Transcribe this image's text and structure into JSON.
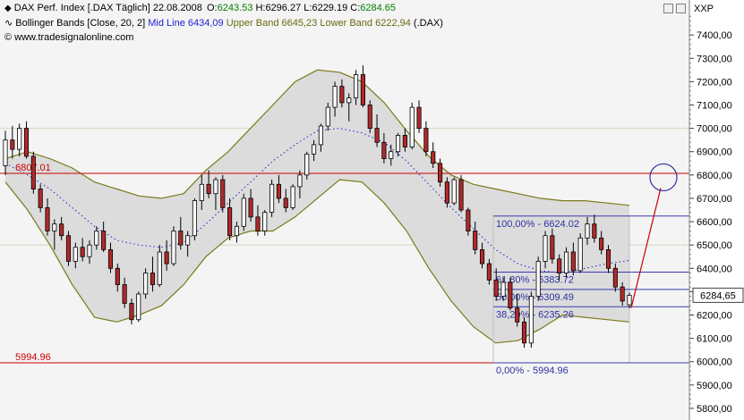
{
  "header": {
    "line1": {
      "icon": "diamond-arrow-icon",
      "symbol": "DAX Perf. Index [.DAX  Täglich]",
      "date": "22.08.2008",
      "open_label": "O:",
      "open_value": "6243.53",
      "high_label": "H:",
      "high_value": "6296.27",
      "low_label": "L:",
      "low_value": "6229.19",
      "close_label": "C:",
      "close_value": "6284.65"
    },
    "line2": {
      "icon": "wave-icon",
      "indicator": "Bollinger Bands [Close, 20, 2]",
      "mid": "Mid Line 6434,09",
      "upper": "Upper Band 6645,23",
      "lower": "Lower Band 6222,94",
      "symbol": "(.DAX)"
    },
    "line3": {
      "icon": "copyright-icon",
      "text": "www.tradesignalonline.com"
    }
  },
  "axis_label": "XXP",
  "price_badge": "6284,65",
  "colors": {
    "candle_up": "#ffffff",
    "candle_down": "#b02a2a",
    "band": "#7a7a1a",
    "band_fill": "#dcdcdc",
    "mid": "#2020d0",
    "fib": "#3a3ab0",
    "fib_label": "#3030a0",
    "hline_red": "#cc0000",
    "open_color": "#008000",
    "high_color": "#000000",
    "close_color": "#008000",
    "upper_color": "#2020d0"
  },
  "chart_data": {
    "type": "candlestick",
    "ylim": [
      5750,
      7550
    ],
    "y_ticks": [
      5800,
      5900,
      6000,
      6100,
      6200,
      6300,
      6400,
      6500,
      6600,
      6700,
      6800,
      6900,
      7000,
      7100,
      7200,
      7300,
      7400
    ],
    "y_tick_labels": [
      "5800,00",
      "5900,00",
      "6000,00",
      "6100,00",
      "6200,00",
      "6300,00",
      "6400,00",
      "6500,00",
      "6600,00",
      "6700,00",
      "6800,00",
      "6900,00",
      "7000,00",
      "7100,00",
      "7200,00",
      "7300,00",
      "7400,00"
    ],
    "green_hlines": [
      7000,
      6500
    ],
    "red_hlines": [
      {
        "value": 6807.01,
        "label": "6807.01"
      },
      {
        "value": 5994.96,
        "label": "5994.96"
      }
    ],
    "fib_levels": [
      {
        "value": 6624.02,
        "label": "100,00% - 6624.02"
      },
      {
        "value": 6383.72,
        "label": "61,80% - 6383.72"
      },
      {
        "value": 6309.49,
        "label": "50,00% - 6309.49"
      },
      {
        "value": 6235.26,
        "label": "38,20% - 6235.26"
      },
      {
        "value": 5994.96,
        "label": "0,00% - 5994.96"
      }
    ],
    "candles": [
      [
        6840,
        6990,
        6800,
        6950
      ],
      [
        6950,
        7010,
        6870,
        6910
      ],
      [
        6910,
        7020,
        6880,
        7000
      ],
      [
        7000,
        7030,
        6870,
        6880
      ],
      [
        6880,
        6900,
        6720,
        6740
      ],
      [
        6740,
        6760,
        6640,
        6660
      ],
      [
        6660,
        6700,
        6540,
        6560
      ],
      [
        6560,
        6610,
        6480,
        6590
      ],
      [
        6590,
        6620,
        6520,
        6540
      ],
      [
        6540,
        6560,
        6410,
        6430
      ],
      [
        6430,
        6510,
        6400,
        6490
      ],
      [
        6490,
        6530,
        6430,
        6450
      ],
      [
        6450,
        6520,
        6420,
        6500
      ],
      [
        6500,
        6580,
        6480,
        6560
      ],
      [
        6560,
        6600,
        6470,
        6480
      ],
      [
        6480,
        6510,
        6380,
        6400
      ],
      [
        6400,
        6420,
        6300,
        6330
      ],
      [
        6330,
        6360,
        6230,
        6250
      ],
      [
        6250,
        6270,
        6160,
        6180
      ],
      [
        6180,
        6300,
        6170,
        6290
      ],
      [
        6290,
        6400,
        6270,
        6380
      ],
      [
        6380,
        6450,
        6300,
        6330
      ],
      [
        6330,
        6500,
        6320,
        6470
      ],
      [
        6470,
        6520,
        6390,
        6420
      ],
      [
        6420,
        6580,
        6410,
        6560
      ],
      [
        6560,
        6620,
        6480,
        6500
      ],
      [
        6500,
        6560,
        6450,
        6540
      ],
      [
        6540,
        6700,
        6520,
        6690
      ],
      [
        6690,
        6800,
        6650,
        6760
      ],
      [
        6760,
        6820,
        6700,
        6720
      ],
      [
        6720,
        6790,
        6650,
        6780
      ],
      [
        6780,
        6800,
        6640,
        6660
      ],
      [
        6660,
        6700,
        6520,
        6540
      ],
      [
        6540,
        6600,
        6510,
        6580
      ],
      [
        6580,
        6720,
        6560,
        6700
      ],
      [
        6700,
        6740,
        6600,
        6620
      ],
      [
        6620,
        6670,
        6540,
        6560
      ],
      [
        6560,
        6650,
        6540,
        6640
      ],
      [
        6640,
        6780,
        6620,
        6760
      ],
      [
        6760,
        6800,
        6680,
        6700
      ],
      [
        6700,
        6740,
        6640,
        6660
      ],
      [
        6660,
        6760,
        6650,
        6750
      ],
      [
        6750,
        6820,
        6700,
        6800
      ],
      [
        6800,
        6900,
        6780,
        6890
      ],
      [
        6890,
        6950,
        6860,
        6930
      ],
      [
        6930,
        7020,
        6900,
        7010
      ],
      [
        7010,
        7110,
        6990,
        7090
      ],
      [
        7090,
        7200,
        7050,
        7180
      ],
      [
        7180,
        7210,
        7090,
        7110
      ],
      [
        7110,
        7150,
        7030,
        7130
      ],
      [
        7130,
        7250,
        7100,
        7230
      ],
      [
        7230,
        7270,
        7090,
        7100
      ],
      [
        7100,
        7120,
        6980,
        7000
      ],
      [
        7000,
        7060,
        6920,
        6940
      ],
      [
        6940,
        6980,
        6850,
        6870
      ],
      [
        6870,
        6930,
        6840,
        6900
      ],
      [
        6900,
        6980,
        6880,
        6970
      ],
      [
        6970,
        7000,
        6900,
        6920
      ],
      [
        6920,
        7110,
        6910,
        7090
      ],
      [
        7090,
        7120,
        6980,
        7000
      ],
      [
        7000,
        7030,
        6880,
        6900
      ],
      [
        6900,
        6940,
        6830,
        6850
      ],
      [
        6850,
        6870,
        6750,
        6770
      ],
      [
        6770,
        6790,
        6660,
        6680
      ],
      [
        6680,
        6790,
        6670,
        6780
      ],
      [
        6780,
        6800,
        6640,
        6650
      ],
      [
        6650,
        6660,
        6540,
        6560
      ],
      [
        6560,
        6600,
        6460,
        6480
      ],
      [
        6480,
        6510,
        6400,
        6420
      ],
      [
        6420,
        6440,
        6330,
        6350
      ],
      [
        6350,
        6400,
        6260,
        6280
      ],
      [
        6280,
        6360,
        6260,
        6340
      ],
      [
        6340,
        6360,
        6220,
        6230
      ],
      [
        6230,
        6290,
        6150,
        6170
      ],
      [
        6170,
        6190,
        6060,
        6080
      ],
      [
        6080,
        6300,
        6060,
        6280
      ],
      [
        6280,
        6450,
        6260,
        6430
      ],
      [
        6430,
        6560,
        6400,
        6540
      ],
      [
        6540,
        6570,
        6420,
        6440
      ],
      [
        6440,
        6460,
        6350,
        6380
      ],
      [
        6380,
        6490,
        6360,
        6470
      ],
      [
        6470,
        6510,
        6370,
        6390
      ],
      [
        6390,
        6550,
        6380,
        6530
      ],
      [
        6530,
        6620,
        6500,
        6590
      ],
      [
        6590,
        6630,
        6510,
        6530
      ],
      [
        6530,
        6560,
        6460,
        6480
      ],
      [
        6480,
        6500,
        6380,
        6400
      ],
      [
        6400,
        6420,
        6300,
        6320
      ],
      [
        6320,
        6340,
        6240,
        6260
      ],
      [
        6243.53,
        6296.27,
        6229.19,
        6284.65
      ]
    ],
    "upper_band": [
      6870,
      6900,
      6870,
      6830,
      6770,
      6740,
      6710,
      6700,
      6720,
      6820,
      6900,
      7000,
      7100,
      7200,
      7250,
      7240,
      7200,
      7110,
      6990,
      6880,
      6800,
      6760,
      6740,
      6720,
      6700,
      6690,
      6690,
      6680,
      6670
    ],
    "lower_band": [
      6770,
      6650,
      6500,
      6330,
      6190,
      6170,
      6200,
      6240,
      6330,
      6450,
      6530,
      6560,
      6560,
      6620,
      6700,
      6780,
      6770,
      6680,
      6560,
      6400,
      6260,
      6150,
      6080,
      6090,
      6140,
      6200,
      6190,
      6180,
      6170
    ],
    "mid_line": [
      6850,
      6800,
      6740,
      6660,
      6580,
      6520,
      6500,
      6490,
      6510,
      6590,
      6680,
      6770,
      6860,
      6930,
      6990,
      7000,
      6980,
      6940,
      6860,
      6760,
      6660,
      6570,
      6480,
      6420,
      6390,
      6380,
      6400,
      6420,
      6434
    ]
  }
}
